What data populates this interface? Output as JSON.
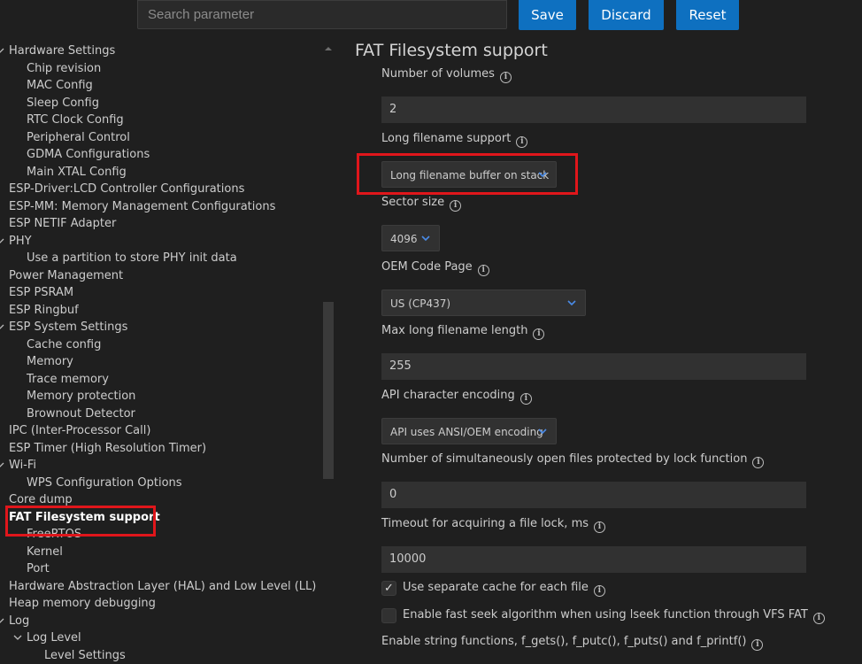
{
  "toolbar": {
    "search_placeholder": "Search parameter",
    "save_label": "Save",
    "discard_label": "Discard",
    "reset_label": "Reset"
  },
  "tree": [
    {
      "label": "Hardware Settings",
      "chevron": "down"
    },
    {
      "label": "Chip revision"
    },
    {
      "label": "MAC Config"
    },
    {
      "label": "Sleep Config"
    },
    {
      "label": "RTC Clock Config"
    },
    {
      "label": "Peripheral Control"
    },
    {
      "label": "GDMA Configurations"
    },
    {
      "label": "Main XTAL Config"
    },
    {
      "label": "ESP-Driver:LCD Controller Configurations"
    },
    {
      "label": "ESP-MM: Memory Management Configurations"
    },
    {
      "label": "ESP NETIF Adapter"
    },
    {
      "label": "PHY",
      "chevron": "down"
    },
    {
      "label": "Use a partition to store PHY init data"
    },
    {
      "label": "Power Management"
    },
    {
      "label": "ESP PSRAM"
    },
    {
      "label": "ESP Ringbuf"
    },
    {
      "label": "ESP System Settings",
      "chevron": "down"
    },
    {
      "label": "Cache config"
    },
    {
      "label": "Memory"
    },
    {
      "label": "Trace memory"
    },
    {
      "label": "Memory protection"
    },
    {
      "label": "Brownout Detector"
    },
    {
      "label": "IPC (Inter-Processor Call)"
    },
    {
      "label": "ESP Timer (High Resolution Timer)"
    },
    {
      "label": "Wi-Fi",
      "chevron": "down"
    },
    {
      "label": "WPS Configuration Options"
    },
    {
      "label": "Core dump"
    },
    {
      "label": "FAT Filesystem support",
      "selected": true
    },
    {
      "label": "FreeRTOS"
    },
    {
      "label": "Kernel"
    },
    {
      "label": "Port"
    },
    {
      "label": "Hardware Abstraction Layer (HAL) and Low Level (LL)"
    },
    {
      "label": "Heap memory debugging"
    },
    {
      "label": "Log",
      "chevron": "down"
    },
    {
      "label": "Log Level",
      "chevron": "down"
    },
    {
      "label": "Level Settings"
    }
  ],
  "content": {
    "title": "FAT Filesystem support",
    "num_volumes": {
      "label": "Number of volumes",
      "value": "2"
    },
    "long_filename": {
      "label": "Long filename support",
      "value": "Long filename buffer on stack"
    },
    "sector_size": {
      "label": "Sector size",
      "value": "4096"
    },
    "oem_code_page": {
      "label": "OEM Code Page",
      "value": "US (CP437)"
    },
    "max_lfn": {
      "label": "Max long filename length",
      "value": "255"
    },
    "api_encoding": {
      "label": "API character encoding",
      "value": "API uses ANSI/OEM encoding"
    },
    "open_files": {
      "label": "Number of simultaneously open files protected by lock function",
      "value": "0"
    },
    "lock_timeout": {
      "label": "Timeout for acquiring a file lock, ms",
      "value": "10000"
    },
    "separate_cache": {
      "label": "Use separate cache for each file",
      "checked": true
    },
    "fast_seek": {
      "label": "Enable fast seek algorithm when using lseek function through VFS FAT",
      "checked": false
    },
    "string_funcs": {
      "label": "Enable string functions, f_gets(), f_putc(), f_puts() and f_printf()"
    }
  },
  "colors": {
    "accent_button": "#0e70c0",
    "highlight_box": "#e0161b",
    "background": "#1f1f1f",
    "input_background": "#313131"
  }
}
